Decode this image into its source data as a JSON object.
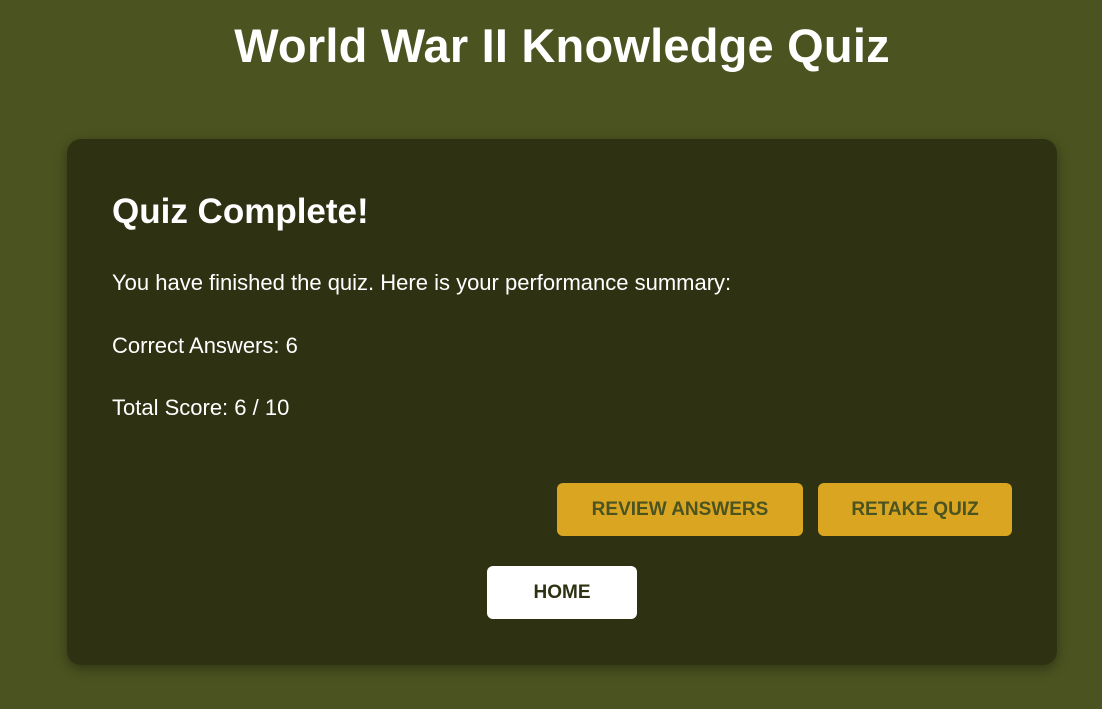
{
  "header": {
    "title": "World War II Knowledge Quiz"
  },
  "results": {
    "heading": "Quiz Complete!",
    "summary": "You have finished the quiz. Here is your performance summary:",
    "correct_answers_text": "Correct Answers: 6",
    "total_score_text": "Total Score: 6 / 10",
    "correct_answers": 6,
    "score": 6,
    "max_score": 10
  },
  "actions": {
    "review_label": "REVIEW ANSWERS",
    "retake_label": "RETAKE QUIZ",
    "home_label": "HOME"
  },
  "colors": {
    "background": "#4b5320",
    "card": "#2e3212",
    "accent": "#daa520",
    "text": "#ffffff"
  }
}
